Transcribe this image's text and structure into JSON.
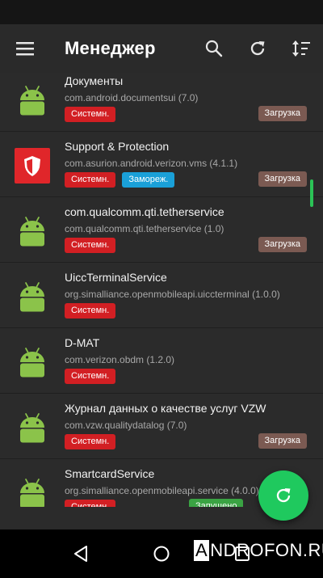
{
  "toolbar": {
    "title": "Менеджер",
    "icons": {
      "menu": "hamburger-icon",
      "search": "search-icon",
      "refresh": "refresh-icon",
      "sort": "sort-icon"
    }
  },
  "apps": [
    {
      "name": "Документы",
      "package": "com.android.documentsui (7.0)",
      "icon": "android-icon",
      "system": "Системн.",
      "load": "Загрузка"
    },
    {
      "name": "Support & Protection",
      "package": "com.asurion.android.verizon.vms (4.1.1)",
      "icon": "shield-icon",
      "system": "Системн.",
      "frozen": "Замореж.",
      "load": "Загрузка"
    },
    {
      "name": "com.qualcomm.qti.tetherservice",
      "package": "com.qualcomm.qti.tetherservice (1.0)",
      "icon": "android-icon",
      "system": "Системн.",
      "load": "Загрузка"
    },
    {
      "name": "UiccTerminalService",
      "package": "org.simalliance.openmobileapi.uiccterminal (1.0.0)",
      "icon": "android-icon",
      "system": "Системн."
    },
    {
      "name": "D-MAT",
      "package": "com.verizon.obdm (1.2.0)",
      "icon": "android-icon",
      "system": "Системн."
    },
    {
      "name": "Журнал данных о качестве услуг VZW",
      "package": "com.vzw.qualitydatalog (7.0)",
      "icon": "android-icon",
      "system": "Системн.",
      "load": "Загрузка"
    },
    {
      "name": "SmartcardService",
      "package": "org.simalliance.openmobileapi.service (4.0.0)",
      "icon": "android-icon",
      "system": "Системн.",
      "running": "Запущено"
    }
  ],
  "fab": {
    "icon": "refresh-icon"
  },
  "navbar": {
    "icons": [
      "back-icon",
      "home-icon",
      "recents-icon"
    ]
  },
  "watermark": {
    "boxed": "A",
    "rest": "NDROFON.RU"
  },
  "colors": {
    "accent": "#1fc95e",
    "system_badge": "#d21f23",
    "frozen_badge": "#1aa0d8",
    "running_badge": "#3aa343",
    "load_badge": "#7b5a52",
    "android_green": "#8bc34a"
  }
}
